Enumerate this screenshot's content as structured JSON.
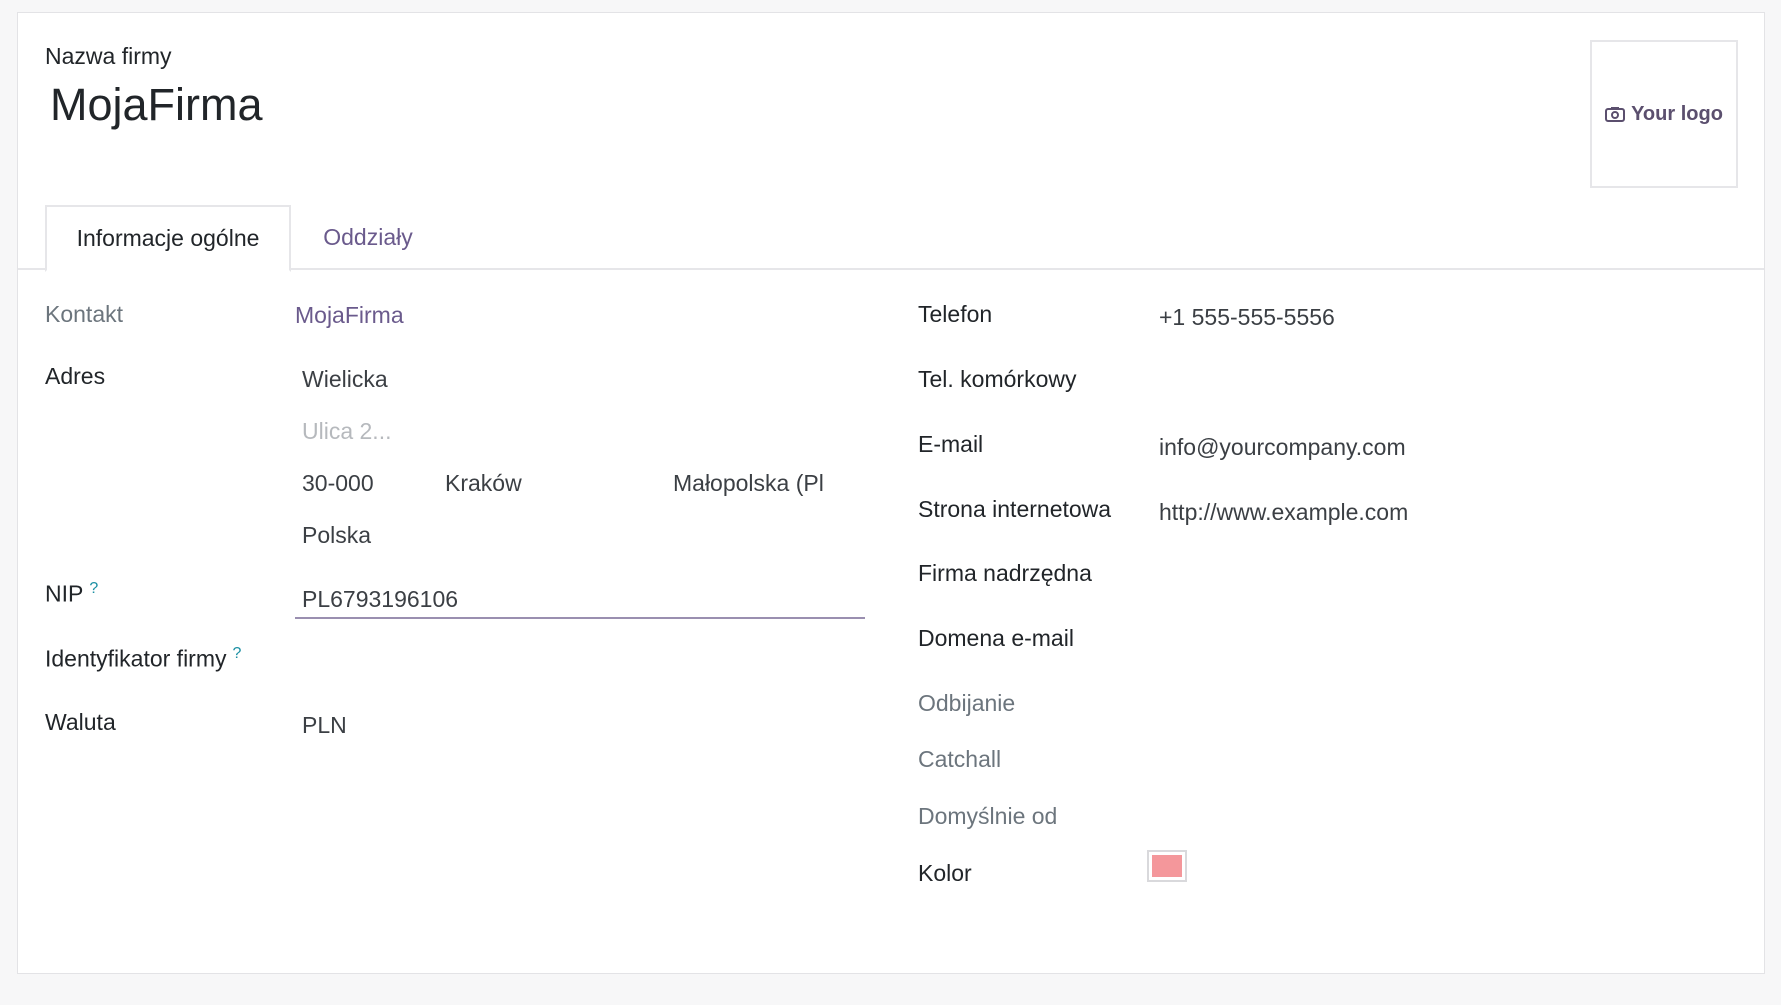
{
  "header": {
    "company_label": "Nazwa firmy",
    "company_name": "MojaFirma",
    "logo_label": "Your logo"
  },
  "tabs": [
    {
      "label": "Informacje ogólne",
      "active": true
    },
    {
      "label": "Oddziały",
      "active": false
    }
  ],
  "left": {
    "contact_label": "Kontakt",
    "contact_value": "MojaFirma",
    "address_label": "Adres",
    "street": "Wielicka",
    "street2_placeholder": "Ulica 2...",
    "zip": "30-000",
    "city": "Kraków",
    "state": "Małopolska (Pl",
    "country": "Polska",
    "nip_label": "NIP",
    "nip_help": "?",
    "nip_value": "PL6793196106",
    "company_id_label": "Identyfikator firmy",
    "company_id_help": "?",
    "currency_label": "Waluta",
    "currency_value": "PLN"
  },
  "right": {
    "phone_label": "Telefon",
    "phone_value": "+1 555-555-5556",
    "mobile_label": "Tel. komórkowy",
    "email_label": "E-mail",
    "email_value": "info@yourcompany.com",
    "website_label": "Strona internetowa",
    "website_value": "http://www.example.com",
    "parent_label": "Firma nadrzędna",
    "email_domain_label": "Domena e-mail",
    "bounce_label": "Odbijanie",
    "catchall_label": "Catchall",
    "default_from_label": "Domyślnie od",
    "color_label": "Kolor"
  },
  "colors": {
    "accent": "#6a5a8c",
    "swatch": "#f4979b",
    "help": "#1a8fa3"
  },
  "icons": {
    "logo": "camera-icon"
  }
}
